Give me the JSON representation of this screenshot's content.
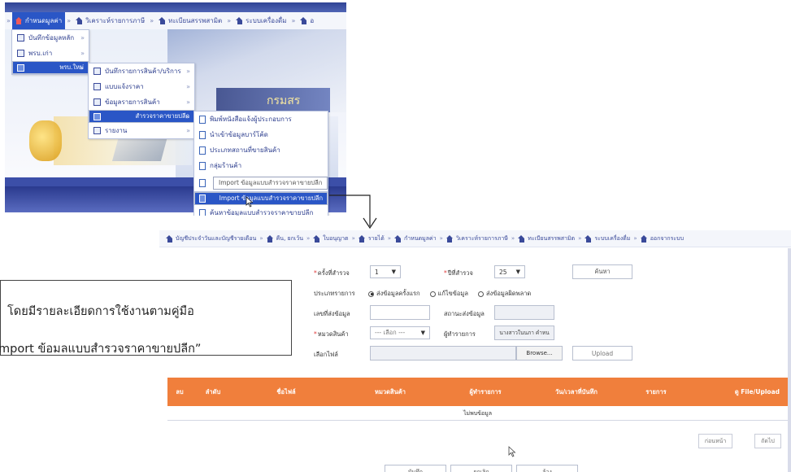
{
  "top_screenshot": {
    "nav": {
      "items": [
        {
          "label": "กำหนดมูลค่า",
          "active": true
        },
        {
          "label": "วิเคราะห์รายการภาษี",
          "active": false
        },
        {
          "label": "ทะเบียนสรรพสามิต",
          "active": false
        },
        {
          "label": "ระบบเครื่องดื่ม",
          "active": false
        },
        {
          "label": "อ",
          "active": false
        }
      ],
      "separator": "»"
    },
    "menu_level1": [
      {
        "label": "บันทึกข้อมูลหลัก",
        "arrow": "»",
        "selected": false
      },
      {
        "label": "พรบ.เก่า",
        "arrow": "»",
        "selected": false
      },
      {
        "label": "พรบ.ใหม่",
        "arrow": "»",
        "selected": true
      }
    ],
    "menu_level2": [
      {
        "label": "บันทึกรายการสินค้า/บริการ",
        "arrow": "»",
        "selected": false
      },
      {
        "label": "แบบแจ้งราคา",
        "arrow": "»",
        "selected": false
      },
      {
        "label": "ข้อมูลรายการสินค้า",
        "arrow": "»",
        "selected": false
      },
      {
        "label": "สำรวจราคาขายปลีก",
        "arrow": "»",
        "selected": true
      },
      {
        "label": "รายงาน",
        "arrow": "»",
        "selected": false
      }
    ],
    "menu_level3": [
      {
        "label": "พิมพ์หนังสือแจ้งผู้ประกอบการ"
      },
      {
        "label": "นำเข้าข้อมูลบาร์โค้ด"
      },
      {
        "label": "ประเภทสถานที่ขายสินค้า"
      },
      {
        "label": "กลุ่มร้านค้า"
      }
    ],
    "tooltip": "Import ข้อมูลแบบสำรวจราคาขายปลีก",
    "highlighted_item": "Import ข้อมูลแบบสำรวจราคาขายปลีก",
    "last_item": "ค้นหาข้อมูลแบบสำรวจราคาขายปลีก",
    "banner_text": "กรมสร"
  },
  "bottom_screenshot": {
    "nav": {
      "items": [
        "บัญชีประจำวันและบัญชีรายเดือน",
        "คืน, ยกเว้น",
        "ใบอนุญาต",
        "รายได้",
        "กำหนดมูลค่า",
        "วิเคราะห์รายการภาษี",
        "ทะเบียนสรรพสามิต",
        "ระบบเครื่องดื่ม",
        "ออกจากระบบ"
      ],
      "separator": "»"
    },
    "form": {
      "survey_round_label": "ครั้งที่สำรวจ",
      "survey_round_value": "1",
      "survey_year_label": "ปีที่สำรวจ",
      "survey_year_value": "25",
      "search_button": "ค้นหา",
      "type_label": "ประเภทรายการ",
      "type_options": [
        {
          "label": "ส่งข้อมูลครั้งแรก",
          "checked": true
        },
        {
          "label": "แก้ไขข้อมูล",
          "checked": false
        },
        {
          "label": "ส่งข้อมูลผิดพลาด",
          "checked": false
        }
      ],
      "submit_no_label": "เลขที่ส่งข้อมูล",
      "submit_status_label": "สถานะส่งข้อมูล",
      "category_label": "หมวดสินค้า",
      "category_placeholder": "--- เลือก ---",
      "reporter_label": "ผู้ทำรายการ",
      "reporter_value": "นางสาวในนภา คำหน",
      "file_label": "เลือกไฟล์",
      "browse_button": "Browse...",
      "upload_button": "Upload"
    },
    "table": {
      "columns": [
        "ลบ",
        "ลำดับ",
        "ชื่อไฟล์",
        "หมวดสินค้า",
        "ผู้ทำรายการ",
        "วัน/เวลาที่บันทึก",
        "รายการ",
        "ดู File/Upload"
      ],
      "empty_text": "ไม่พบข้อมูล"
    },
    "pagination": {
      "prev": "ก่อนหน้า",
      "next": "ถัดไป"
    },
    "bottom_buttons": [
      "บันทึก",
      "ยกเลิก",
      "ล้าง"
    ]
  },
  "callout": {
    "line1": "โดยมีรายละเอียดการใช้งานตามคู่มือ",
    "line2": "mport ข้อมลแบบสำรวจราคาขายปลีก”"
  }
}
